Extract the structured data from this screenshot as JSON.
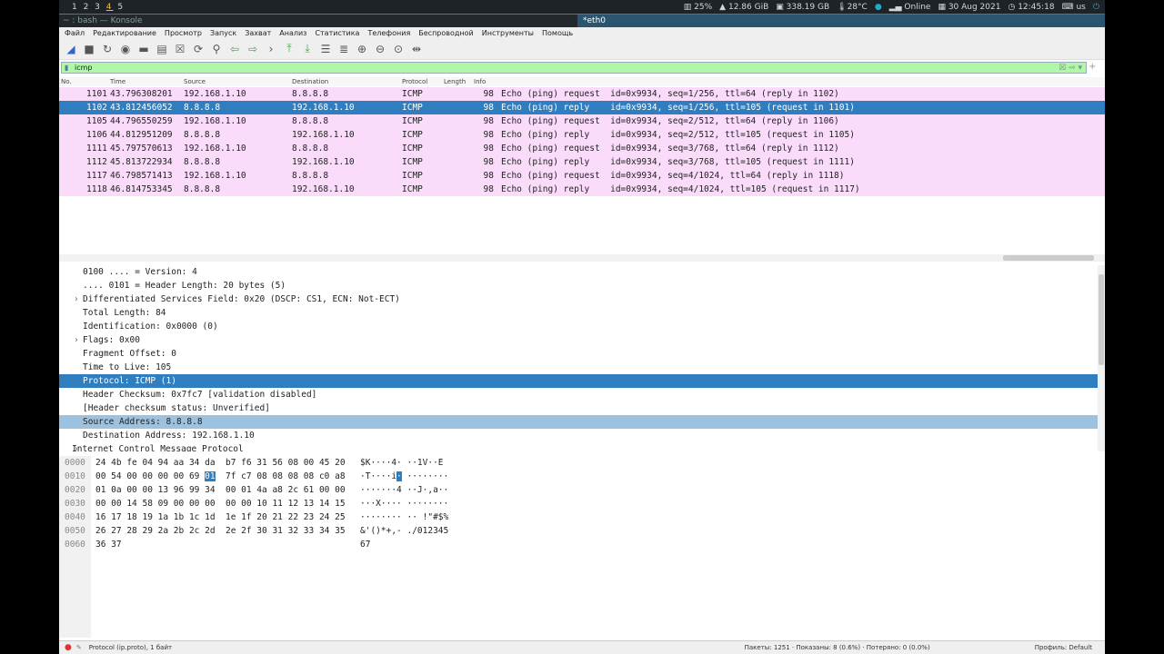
{
  "topbar": {
    "workspaces_before": "1 2 3 ",
    "workspace_active": "4",
    "workspaces_after": " 5",
    "cpu": "25%",
    "mem": "12.86 GiB",
    "disk": "338.19 GB",
    "temp": "28°C",
    "network": "Online",
    "date": "30 Aug 2021",
    "time": "12:45:18",
    "layout": "us"
  },
  "konsole_title": "~ : bash — Konsole",
  "window_title": "*eth0",
  "menu": [
    "Файл",
    "Редактирование",
    "Просмотр",
    "Запуск",
    "Захват",
    "Анализ",
    "Статистика",
    "Телефония",
    "Беспроводной",
    "Инструменты",
    "Помощь"
  ],
  "toolbar_icons": [
    "shark-fin-start-icon",
    "stop-icon",
    "restart-icon",
    "options-gear-icon",
    "open-folder-icon",
    "save-file-icon",
    "close-file-icon",
    "reload-icon",
    "search-icon",
    "back-arrow-icon",
    "forward-arrow-icon",
    "go-to-packet-icon",
    "first-packet-icon",
    "last-packet-icon",
    "autoscroll-icon",
    "colorize-icon",
    "zoom-in-icon",
    "zoom-out-icon",
    "zoom-normal-icon",
    "resize-columns-icon"
  ],
  "filter": {
    "value": "icmp",
    "color": "#b0f7a8"
  },
  "columns": [
    "No.",
    "Time",
    "Source",
    "Destination",
    "Protocol",
    "Length",
    "Info"
  ],
  "packets": [
    [
      "1101",
      "43.796308201",
      "192.168.1.10",
      "8.8.8.8",
      "ICMP",
      "98",
      "Echo (ping) request  id=0x9934, seq=1/256, ttl=64 (reply in 1102)"
    ],
    [
      "1102",
      "43.812456052",
      "8.8.8.8",
      "192.168.1.10",
      "ICMP",
      "98",
      "Echo (ping) reply    id=0x9934, seq=1/256, ttl=105 (request in 1101)"
    ],
    [
      "1105",
      "44.796550259",
      "192.168.1.10",
      "8.8.8.8",
      "ICMP",
      "98",
      "Echo (ping) request  id=0x9934, seq=2/512, ttl=64 (reply in 1106)"
    ],
    [
      "1106",
      "44.812951209",
      "8.8.8.8",
      "192.168.1.10",
      "ICMP",
      "98",
      "Echo (ping) reply    id=0x9934, seq=2/512, ttl=105 (request in 1105)"
    ],
    [
      "1111",
      "45.797570613",
      "192.168.1.10",
      "8.8.8.8",
      "ICMP",
      "98",
      "Echo (ping) request  id=0x9934, seq=3/768, ttl=64 (reply in 1112)"
    ],
    [
      "1112",
      "45.813722934",
      "8.8.8.8",
      "192.168.1.10",
      "ICMP",
      "98",
      "Echo (ping) reply    id=0x9934, seq=3/768, ttl=105 (request in 1111)"
    ],
    [
      "1117",
      "46.798571413",
      "192.168.1.10",
      "8.8.8.8",
      "ICMP",
      "98",
      "Echo (ping) request  id=0x9934, seq=4/1024, ttl=64 (reply in 1118)"
    ],
    [
      "1118",
      "46.814753345",
      "8.8.8.8",
      "192.168.1.10",
      "ICMP",
      "98",
      "Echo (ping) reply    id=0x9934, seq=4/1024, ttl=105 (request in 1117)"
    ]
  ],
  "selected_packet": "1102",
  "details": [
    "0100 .... = Version: 4",
    ".... 0101 = Header Length: 20 bytes (5)",
    "Differentiated Services Field: 0x20 (DSCP: CS1, ECN: Not-ECT)",
    "Total Length: 84",
    "Identification: 0x0000 (0)",
    "Flags: 0x00",
    "Fragment Offset: 0",
    "Time to Live: 105",
    "Protocol: ICMP (1)",
    "Header Checksum: 0x7fc7 [validation disabled]",
    "[Header checksum status: Unverified]",
    "Source Address: 8.8.8.8",
    "Destination Address: 192.168.1.10",
    "Internet Control Message Protocol"
  ],
  "hex": [
    [
      "0000",
      "24 4b fe 04 94 aa 34 da  b7 f6 31 56 08 00 45 20",
      "$K····4· ··1V··E "
    ],
    [
      "0010",
      "00 54 00 00 00 00 69 ",
      "·T····i"
    ],
    [
      "0020",
      "01 0a 00 00 13 96 99 34  00 01 4a a8 2c 61 00 00",
      "·······4 ··J·,a··"
    ],
    [
      "0030",
      "00 00 14 58 09 00 00 00  00 00 10 11 12 13 14 15",
      "···X···· ········"
    ],
    [
      "0040",
      "16 17 18 19 1a 1b 1c 1d  1e 1f 20 21 22 23 24 25",
      "········ ·· !\"#$%"
    ],
    [
      "0050",
      "26 27 28 29 2a 2b 2c 2d  2e 2f 30 31 32 33 34 35",
      "&'()*+,- ./012345"
    ],
    [
      "0060",
      "36 37",
      "67"
    ]
  ],
  "hex_sel": {
    "byte": "01",
    "rest": "  7f c7 08 08 08 08 c0 a8",
    "ascii_sel": "·",
    "ascii_rest": " ········"
  },
  "status": {
    "field": "Protocol (ip.proto), 1 байт",
    "packets": "Пакеты: 1251 · Показаны: 8 (0.6%) · Потеряно: 0 (0.0%)",
    "profile": "Профиль: Default"
  },
  "colors": {
    "row_bg": "#fadcfa",
    "selection": "#2e7ec0",
    "highlight": "#9cc2e0"
  }
}
